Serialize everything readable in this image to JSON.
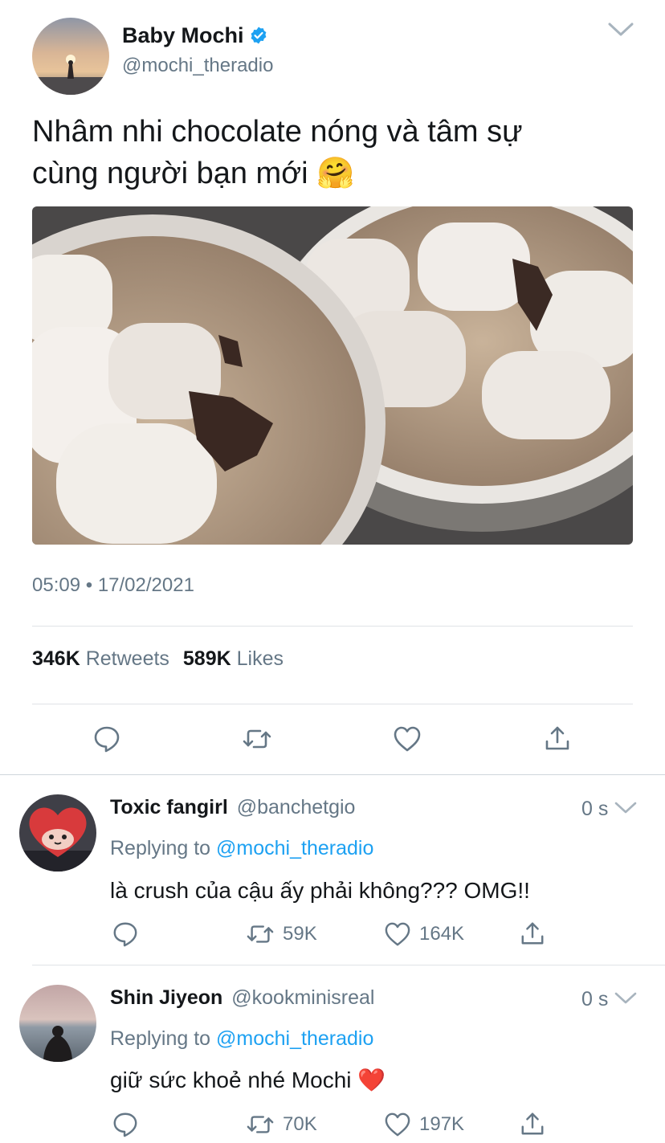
{
  "tweet": {
    "author_name": "Baby Mochi",
    "author_handle": "@mochi_theradio",
    "text_line1": "Nhâm nhi chocolate nóng và tâm sự",
    "text_line2": "cùng người bạn mới",
    "emoji": "🤗",
    "time": "05:09",
    "date": "17/02/2021",
    "retweets_count": "346K",
    "retweets_label": "Retweets",
    "likes_count": "589K",
    "likes_label": "Likes"
  },
  "replies": [
    {
      "name": "Toxic fangirl",
      "handle": "@banchetgio",
      "time": "0 s",
      "replying_prefix": "Replying to",
      "replying_handle": "@mochi_theradio",
      "text": "là crush của cậu ấy phải không??? OMG!!",
      "retweets": "59K",
      "likes": "164K"
    },
    {
      "name": "Shin Jiyeon",
      "handle": "@kookminisreal",
      "time": "0 s",
      "replying_prefix": "Replying to",
      "replying_handle": "@mochi_theradio",
      "text": "giữ sức khoẻ nhé Mochi",
      "emoji": "❤️",
      "retweets": "70K",
      "likes": "197K"
    }
  ],
  "icons": {
    "verified": "verified-badge-icon",
    "menu": "chevron-down-icon",
    "reply": "reply-icon",
    "retweet": "retweet-icon",
    "like": "heart-icon",
    "share": "share-icon"
  },
  "colors": {
    "text": "#14171a",
    "secondary": "#657786",
    "accent": "#1da1f2",
    "divider": "#dfe3e6"
  }
}
